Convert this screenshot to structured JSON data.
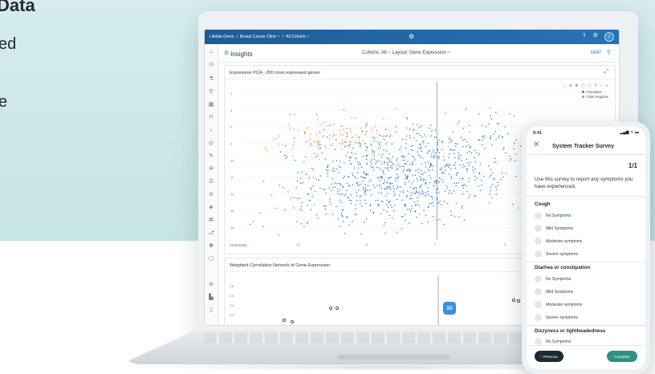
{
  "headline": {
    "bold_text": "Data",
    "line2": "ed",
    "line3": "e"
  },
  "app": {
    "breadcrumb": [
      "Lifebits Demo",
      "/",
      "Breast Cancer Clinic ~",
      "/",
      "All Cohorts ~"
    ],
    "center_icon": "gear-icon",
    "avatar": "C",
    "toolbar": {
      "title": "Insights",
      "cohorts": "Cohorts: All ~   Layout: Gene Expression ~",
      "map": "MAP"
    },
    "card1": {
      "title": "Expression PCA - 200 most expressed genes",
      "legend": [
        "Population",
        "Triple Negative"
      ],
      "view_data": "View Data"
    },
    "card2": {
      "title": "Weighted Correlation Network of Gene Expression"
    }
  },
  "phone": {
    "time": "9:41",
    "title": "System Tracker Survey",
    "page": "1/1",
    "intro": "Use this survey to report any symptoms you have experienced.",
    "sections": [
      {
        "title": "Cough",
        "options": [
          "No Symptoms",
          "Mild Symptoms",
          "Moderate symptoms",
          "Severe symptoms"
        ]
      },
      {
        "title": "Diarhea or constipation",
        "options": [
          "No Symptoms",
          "Mild Symptoms",
          "Moderate symptoms",
          "Severe symptoms"
        ]
      },
      {
        "title": "Dizzyness or lightheadedness",
        "options": [
          "No Symptoms"
        ]
      }
    ],
    "prev_label": "Previous",
    "complete_label": "Complete"
  },
  "chart_data": {
    "type": "scatter",
    "title": "Expression PCA - 200 most expressed genes",
    "xlabel": "",
    "ylabel": "",
    "x_ticks": [
      "-10",
      "-5",
      "0",
      "5"
    ],
    "y_ticks": [
      "-2",
      "-4",
      "-6",
      "-8",
      "-10",
      "-12",
      "-14",
      "-16",
      "-18"
    ],
    "xlim": [
      -14,
      9
    ],
    "ylim": [
      -19,
      -1
    ],
    "legend": [
      "Population",
      "Triple Negative"
    ],
    "series_colors": [
      "#2c7fc1",
      "#ef8a3c"
    ]
  },
  "colors": {
    "brand_blue": "#2672b6",
    "teal_accent": "#2e8f86",
    "background_teal": "#d6ecee"
  }
}
